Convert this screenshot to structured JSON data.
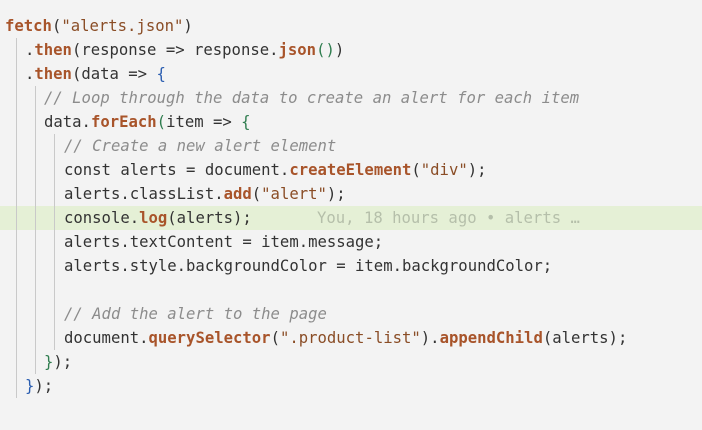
{
  "editor": {
    "lines": [
      {
        "id": "l1",
        "tokens": [
          {
            "c": "fn",
            "t": "fetch"
          },
          {
            "c": "pun",
            "t": "("
          },
          {
            "c": "str",
            "t": "\"alerts.json\""
          },
          {
            "c": "pun",
            "t": ")"
          }
        ]
      },
      {
        "id": "l2",
        "tokens": [
          {
            "c": "pun",
            "t": "."
          },
          {
            "c": "fn",
            "t": "then"
          },
          {
            "c": "pun",
            "t": "("
          },
          {
            "c": "txt",
            "t": "response => response."
          },
          {
            "c": "fn",
            "t": "json"
          },
          {
            "c": "br2",
            "t": "()"
          },
          {
            "c": "pun",
            "t": ")"
          }
        ]
      },
      {
        "id": "l3",
        "tokens": [
          {
            "c": "pun",
            "t": "."
          },
          {
            "c": "fn",
            "t": "then"
          },
          {
            "c": "pun",
            "t": "("
          },
          {
            "c": "txt",
            "t": "data => "
          },
          {
            "c": "br1",
            "t": "{"
          }
        ]
      },
      {
        "id": "l4",
        "tokens": [
          {
            "c": "com",
            "t": "// Loop through the data to create an alert for each item"
          }
        ]
      },
      {
        "id": "l5",
        "tokens": [
          {
            "c": "txt",
            "t": "data."
          },
          {
            "c": "fn",
            "t": "forEach"
          },
          {
            "c": "br2",
            "t": "("
          },
          {
            "c": "txt",
            "t": "item => "
          },
          {
            "c": "br2",
            "t": "{"
          }
        ]
      },
      {
        "id": "l6",
        "tokens": [
          {
            "c": "com",
            "t": "// Create a new alert element"
          }
        ]
      },
      {
        "id": "l7",
        "tokens": [
          {
            "c": "txt",
            "t": "const alerts = document."
          },
          {
            "c": "fn",
            "t": "createElement"
          },
          {
            "c": "pun",
            "t": "("
          },
          {
            "c": "str",
            "t": "\"div\""
          },
          {
            "c": "pun",
            "t": ");"
          }
        ]
      },
      {
        "id": "l8",
        "tokens": [
          {
            "c": "txt",
            "t": "alerts.classList."
          },
          {
            "c": "fn",
            "t": "add"
          },
          {
            "c": "pun",
            "t": "("
          },
          {
            "c": "str",
            "t": "\"alert\""
          },
          {
            "c": "pun",
            "t": ");"
          }
        ]
      },
      {
        "id": "l9",
        "tokens": [
          {
            "c": "txt",
            "t": "console."
          },
          {
            "c": "fn",
            "t": "log"
          },
          {
            "c": "pun",
            "t": "(alerts);"
          }
        ]
      },
      {
        "id": "l10",
        "tokens": [
          {
            "c": "txt",
            "t": "alerts.textContent = item.message;"
          }
        ]
      },
      {
        "id": "l11",
        "tokens": [
          {
            "c": "txt",
            "t": "alerts.style.backgroundColor = item.backgroundColor;"
          }
        ]
      },
      {
        "id": "l12",
        "tokens": []
      },
      {
        "id": "l13",
        "tokens": [
          {
            "c": "com",
            "t": "// Add the alert to the page"
          }
        ]
      },
      {
        "id": "l14",
        "tokens": [
          {
            "c": "txt",
            "t": "document."
          },
          {
            "c": "fn",
            "t": "querySelector"
          },
          {
            "c": "pun",
            "t": "("
          },
          {
            "c": "str",
            "t": "\".product-list\""
          },
          {
            "c": "pun",
            "t": ")."
          },
          {
            "c": "fn",
            "t": "appendChild"
          },
          {
            "c": "pun",
            "t": "(alerts);"
          }
        ]
      },
      {
        "id": "l15",
        "tokens": [
          {
            "c": "br2",
            "t": "}"
          },
          {
            "c": "pun",
            "t": ");"
          }
        ]
      },
      {
        "id": "l16",
        "tokens": [
          {
            "c": "br1",
            "t": "}"
          },
          {
            "c": "pun",
            "t": ");"
          }
        ]
      }
    ],
    "blame": "You, 18 hours ago • alerts …",
    "colors": {
      "background": "#f3f3f3",
      "highlight": "#e5f0d6",
      "function": "#a8542a",
      "string": "#8a4d26",
      "comment": "#8c8c8c",
      "text": "#333333"
    }
  }
}
